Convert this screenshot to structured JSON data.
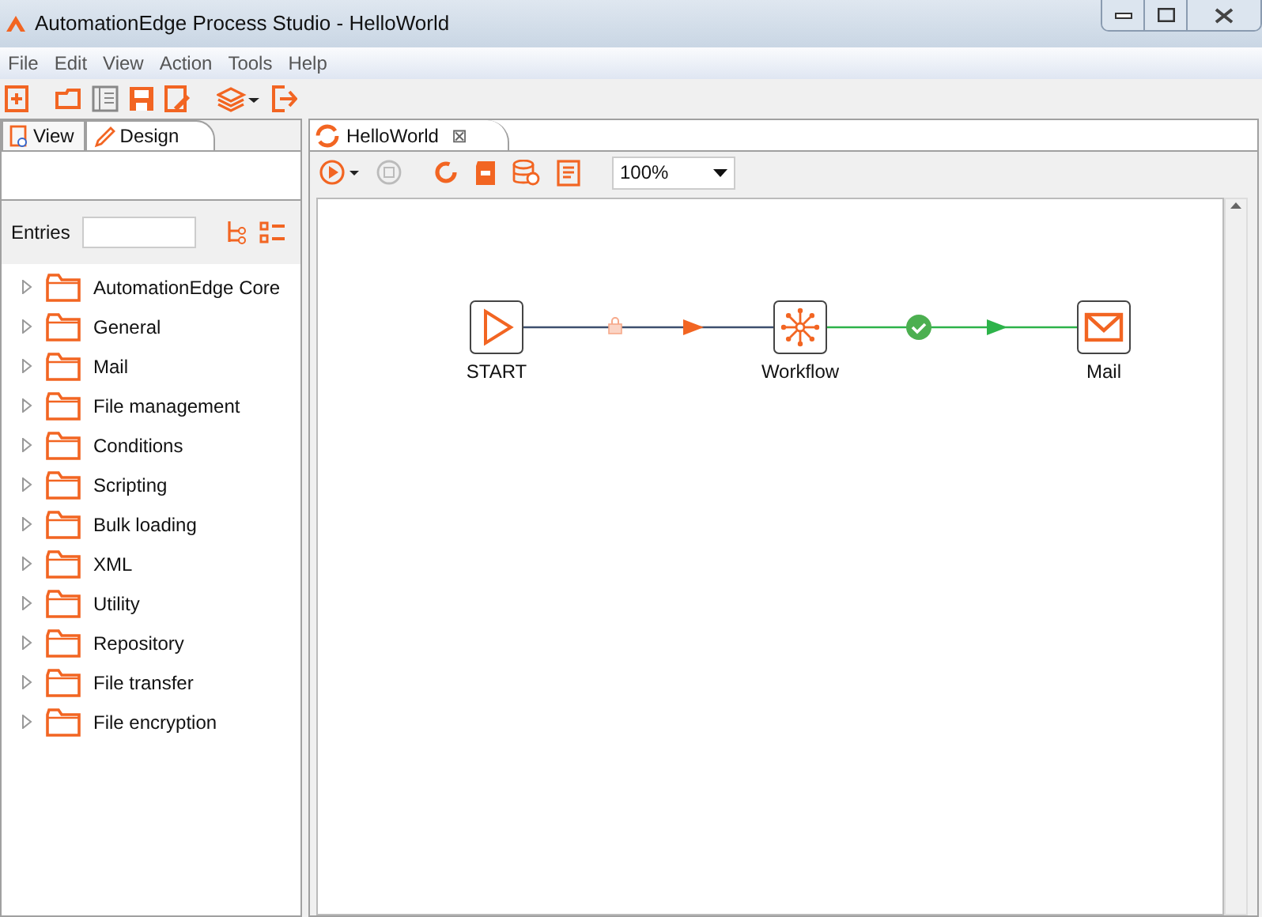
{
  "window": {
    "title": "AutomationEdge Process Studio - HelloWorld"
  },
  "menu": [
    "File",
    "Edit",
    "View",
    "Action",
    "Tools",
    "Help"
  ],
  "left_tabs": [
    {
      "label": "View",
      "selected": false
    },
    {
      "label": "Design",
      "selected": true
    }
  ],
  "entries_label": "Entries",
  "tree": [
    {
      "label": "AutomationEdge Core",
      "expanded": false
    },
    {
      "label": "General",
      "expanded": false
    },
    {
      "label": "Mail",
      "expanded": false
    },
    {
      "label": "File management",
      "expanded": false
    },
    {
      "label": "Conditions",
      "expanded": false
    },
    {
      "label": "Scripting",
      "expanded": false
    },
    {
      "label": "Bulk loading",
      "expanded": false
    },
    {
      "label": "XML",
      "expanded": false
    },
    {
      "label": "Utility",
      "expanded": false
    },
    {
      "label": "Repository",
      "expanded": false
    },
    {
      "label": "File transfer",
      "expanded": false
    },
    {
      "label": "File encryption",
      "expanded": false
    }
  ],
  "editor_tab": {
    "label": "HelloWorld",
    "close": "⊠"
  },
  "zoom": "100%",
  "nodes": [
    {
      "label": "START",
      "kind": "start"
    },
    {
      "label": "Workflow",
      "kind": "workflow"
    },
    {
      "label": "Mail",
      "kind": "mail"
    }
  ],
  "hops": [
    {
      "kind": "unconditional"
    },
    {
      "kind": "success"
    }
  ]
}
